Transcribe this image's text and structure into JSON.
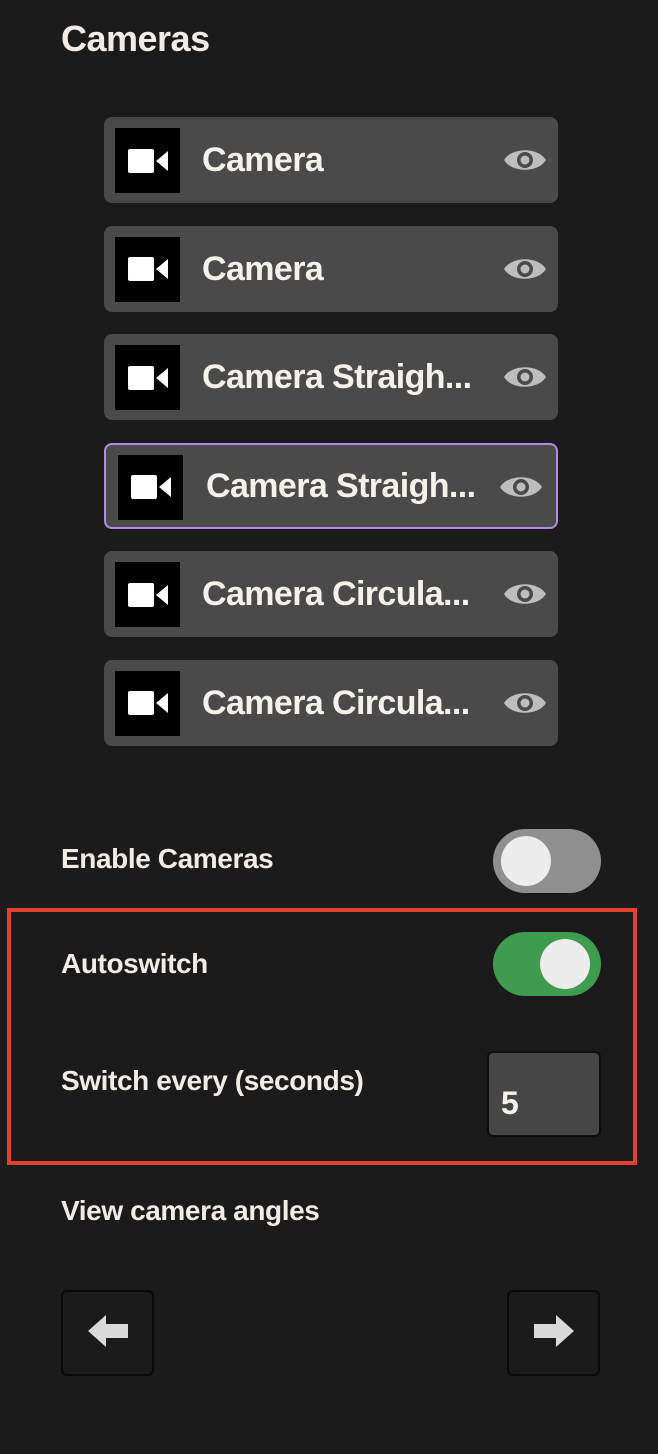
{
  "panel": {
    "title": "Cameras"
  },
  "cameras": [
    {
      "label": "Camera",
      "icon": "video-camera-icon",
      "visibility_icon": "eye-icon",
      "selected": false
    },
    {
      "label": "Camera",
      "icon": "video-camera-icon",
      "visibility_icon": "eye-icon",
      "selected": false
    },
    {
      "label": "Camera Straigh...",
      "icon": "video-camera-icon",
      "visibility_icon": "eye-icon",
      "selected": false
    },
    {
      "label": "Camera Straigh...",
      "icon": "video-camera-icon",
      "visibility_icon": "eye-icon",
      "selected": true
    },
    {
      "label": "Camera Circula...",
      "icon": "video-camera-icon",
      "visibility_icon": "eye-icon",
      "selected": false
    },
    {
      "label": "Camera Circula...",
      "icon": "video-camera-icon",
      "visibility_icon": "eye-icon",
      "selected": false
    }
  ],
  "settings": {
    "enable_cameras_label": "Enable Cameras",
    "enable_cameras_on": false,
    "autoswitch_label": "Autoswitch",
    "autoswitch_on": true,
    "switch_every_label": "Switch every (seconds)",
    "switch_every_value": "5"
  },
  "angles": {
    "title": "View camera angles",
    "prev_icon": "arrow-left-icon",
    "next_icon": "arrow-right-icon"
  },
  "colors": {
    "background": "#1b1b1b",
    "item_background": "#4a4a4a",
    "selected_border": "#b688e8",
    "toggle_on": "#3f9b4f",
    "toggle_off": "#8f8f8f",
    "highlight": "#e2412d"
  }
}
